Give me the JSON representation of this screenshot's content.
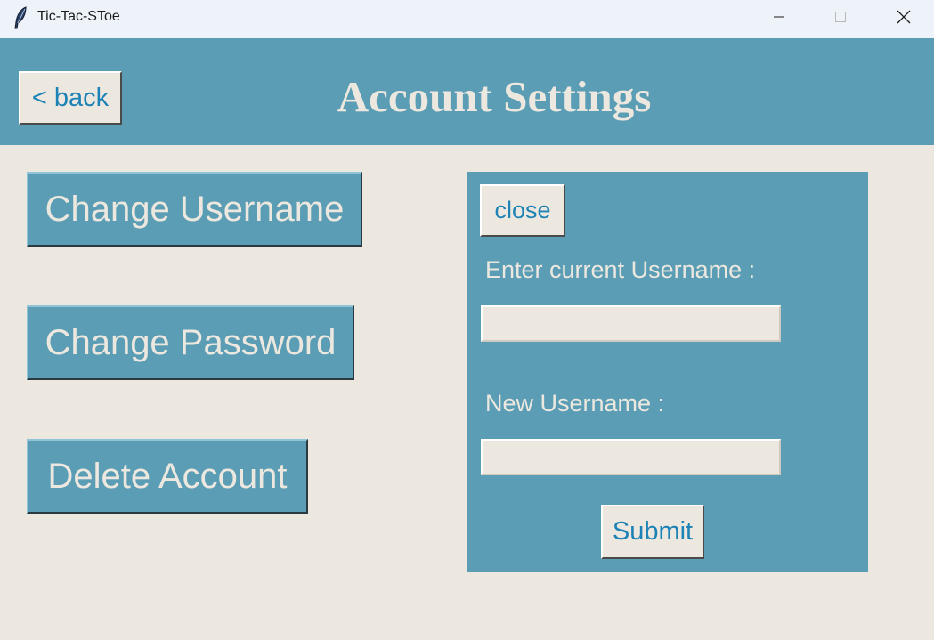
{
  "window": {
    "title": "Tic-Tac-SToe",
    "app_icon": "feather-icon",
    "controls": [
      "minimize-icon",
      "maximize-icon",
      "close-icon"
    ]
  },
  "header": {
    "back_label": "< back",
    "title": "Account Settings"
  },
  "actions": {
    "change_username": "Change Username",
    "change_password": "Change Password",
    "delete_account": "Delete Account"
  },
  "panel": {
    "close_label": "close",
    "current_username_label": "Enter current Username :",
    "current_username_value": "",
    "new_username_label": "New Username :",
    "new_username_value": "",
    "submit_label": "Submit"
  },
  "colors": {
    "accent": "#5b9db4",
    "background": "#ece8e0",
    "button_text": "#1d82b5",
    "title_text": "#ece8e0"
  }
}
